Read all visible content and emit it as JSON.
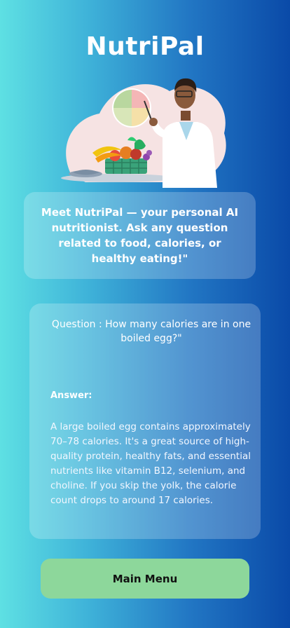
{
  "app": {
    "title": "NutriPal"
  },
  "hero": {
    "illustration": "nutritionist-with-vegetable-basket-and-plate-chart"
  },
  "intro": {
    "text": "Meet NutriPal — your personal AI nutritionist. Ask any question related to food, calories, or healthy eating!\""
  },
  "qa": {
    "question": "Question : How many calories are in one boiled egg?\"",
    "answer_label": "Answer:",
    "answer": "A large boiled egg contains approximately 70–78 calories. It's a great source of high-quality protein, healthy fats, and essential nutrients like vitamin B12, selenium, and choline. If you skip the yolk, the calorie count drops to around 17 calories."
  },
  "actions": {
    "main_menu_label": "Main Menu"
  },
  "colors": {
    "button_bg": "#8dd79b",
    "gradient_start": "#5ee0e3",
    "gradient_end": "#0a4aa8"
  }
}
